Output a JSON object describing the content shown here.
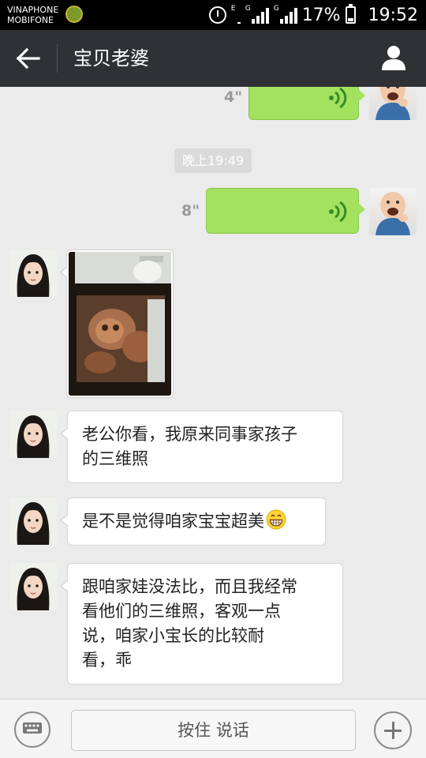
{
  "status_bar": {
    "carrier_line1": "VINAPHONE",
    "carrier_line2": "MOBIFONE",
    "network_e": "E",
    "network_g1": "G",
    "network_g2": "G",
    "battery": "17%",
    "time": "19:52"
  },
  "header": {
    "title": "宝贝老婆",
    "back_icon": "back-arrow-icon",
    "profile_icon": "person-icon"
  },
  "messages": [
    {
      "type": "voice",
      "sender": "me",
      "duration": "4\""
    },
    {
      "type": "timestamp",
      "text": "晚上19:49"
    },
    {
      "type": "voice",
      "sender": "me",
      "duration": "8\""
    },
    {
      "type": "image",
      "sender": "wife"
    },
    {
      "type": "text",
      "sender": "wife",
      "lines": [
        "老公你看，我原来同事家孩子",
        "的三维照"
      ]
    },
    {
      "type": "text",
      "sender": "wife",
      "text": "是不是觉得咱家宝宝超美",
      "emoji": "grin-emoji"
    },
    {
      "type": "text",
      "sender": "wife",
      "lines": [
        "跟咱家娃没法比，而且我经常",
        "看他们的三维照，客观一点",
        "说，咱家小宝长的比较耐",
        "看，乖"
      ]
    }
  ],
  "input_bar": {
    "hold_to_talk": "按住 说话",
    "keyboard_icon": "keyboard-icon",
    "plus_icon": "plus-icon"
  },
  "colors": {
    "header_bg": "#2f3134",
    "chat_bg": "#ebebeb",
    "voice_bubble": "#a3e25e"
  }
}
